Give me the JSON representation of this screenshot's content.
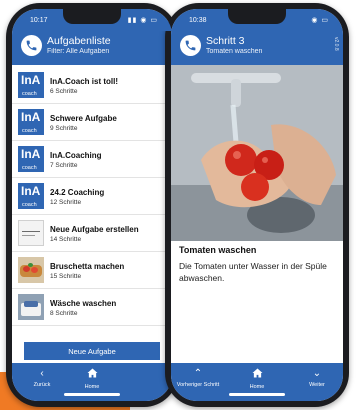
{
  "left_screen": {
    "status_time": "10:17",
    "title": "Aufgabenliste",
    "subtitle": "Filter: Alle Aufgaben",
    "tasks": [
      {
        "title": "InA.Coach ist toll!",
        "steps": "6 Schritte",
        "thumb": "ina-coach-logo"
      },
      {
        "title": "Schwere Aufgabe",
        "steps": "9 Schritte",
        "thumb": "ina-coach-logo"
      },
      {
        "title": "InA.Coaching",
        "steps": "7 Schritte",
        "thumb": "ina-coach-logo"
      },
      {
        "title": "24.2 Coaching",
        "steps": "12 Schritte",
        "thumb": "ina-coach-logo"
      },
      {
        "title": "Neue Aufgabe erstellen",
        "steps": "14 Schritte",
        "thumb": "document-image"
      },
      {
        "title": "Bruschetta machen",
        "steps": "15 Schritte",
        "thumb": "bruschetta-photo"
      },
      {
        "title": "Wäsche waschen",
        "steps": "8 Schritte",
        "thumb": "laundry-photo"
      }
    ],
    "thumb_logo_text": "InA",
    "thumb_logo_sub": "coach",
    "new_task_button": "Neue Aufgabe",
    "nav": {
      "back_label": "Zurück",
      "home_label": "Home"
    }
  },
  "right_screen": {
    "status_time": "10:38",
    "title": "Schritt 3",
    "subtitle": "Tomaten waschen",
    "version": "v2.0.8",
    "step_title": "Tomaten waschen",
    "step_description": "Die Tomaten unter Wasser in der Spüle abwaschen.",
    "nav": {
      "prev_label": "Vorheriger Schritt",
      "home_label": "Home",
      "next_label": "Weiter"
    }
  },
  "colors": {
    "accent": "#2f66b3",
    "orange": "#f07a24",
    "phone_frame": "#1b1c20"
  },
  "icons": {
    "logo": "phone-handset-icon",
    "back": "chevron-left-icon",
    "home": "home-icon",
    "up": "chevron-up-icon",
    "down": "chevron-down-icon"
  }
}
